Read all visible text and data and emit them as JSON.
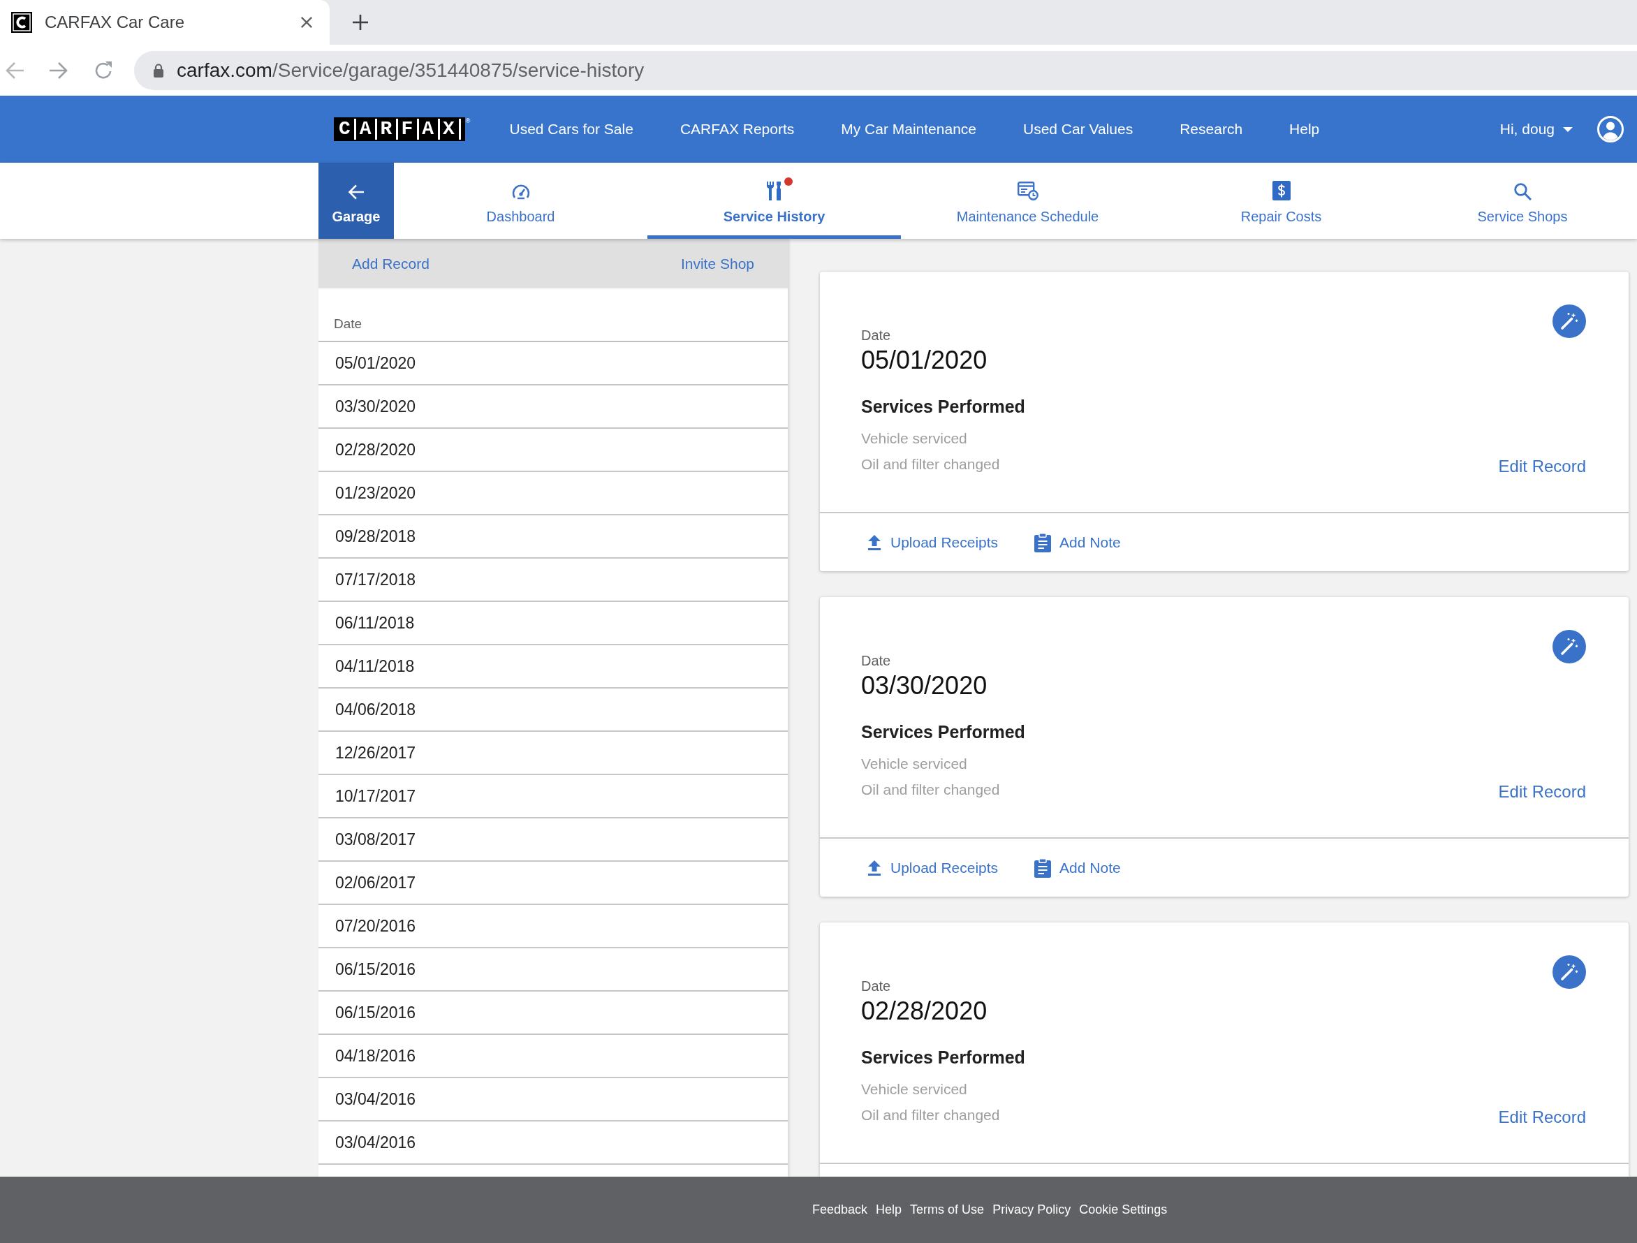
{
  "browser": {
    "tab_title": "CARFAX Car Care",
    "url_host": "carfax.com",
    "url_path": "/Service/garage/351440875/service-history"
  },
  "site_nav": {
    "logo": "CARFAX",
    "logo_mark": "®",
    "links": [
      "Used Cars for Sale",
      "CARFAX Reports",
      "My Car Maintenance",
      "Used Car Values",
      "Research",
      "Help"
    ],
    "user_menu": "Hi, doug"
  },
  "sub_nav": {
    "back": "Garage",
    "tabs": [
      {
        "label": "Dashboard",
        "selected": false,
        "alert": false
      },
      {
        "label": "Service History",
        "selected": true,
        "alert": true
      },
      {
        "label": "Maintenance Schedule",
        "selected": false,
        "alert": false
      },
      {
        "label": "Repair Costs",
        "selected": false,
        "alert": false
      },
      {
        "label": "Service Shops",
        "selected": false,
        "alert": false
      }
    ]
  },
  "records_panel": {
    "actions": [
      "Add Record",
      "Invite Shop"
    ],
    "column": "Date",
    "rows": [
      "05/01/2020",
      "03/30/2020",
      "02/28/2020",
      "01/23/2020",
      "09/28/2018",
      "07/17/2018",
      "06/11/2018",
      "04/11/2018",
      "04/06/2018",
      "12/26/2017",
      "10/17/2017",
      "03/08/2017",
      "02/06/2017",
      "07/20/2016",
      "06/15/2016",
      "06/15/2016",
      "04/18/2016",
      "03/04/2016",
      "03/04/2016"
    ]
  },
  "record_cards": [
    {
      "date_label": "Date",
      "date": "05/01/2020",
      "services_heading": "Services Performed",
      "services": [
        "Vehicle serviced",
        "Oil and filter changed"
      ],
      "edit_label": "Edit Record",
      "actions": [
        "Upload Receipts",
        "Add Note"
      ]
    },
    {
      "date_label": "Date",
      "date": "03/30/2020",
      "services_heading": "Services Performed",
      "services": [
        "Vehicle serviced",
        "Oil and filter changed"
      ],
      "edit_label": "Edit Record",
      "actions": [
        "Upload Receipts",
        "Add Note"
      ]
    },
    {
      "date_label": "Date",
      "date": "02/28/2020",
      "services_heading": "Services Performed",
      "services": [
        "Vehicle serviced",
        "Oil and filter changed"
      ],
      "edit_label": "Edit Record"
    }
  ],
  "footer": {
    "links": [
      "Feedback",
      "Help",
      "Terms of Use",
      "Privacy Policy",
      "Cookie Settings"
    ]
  }
}
